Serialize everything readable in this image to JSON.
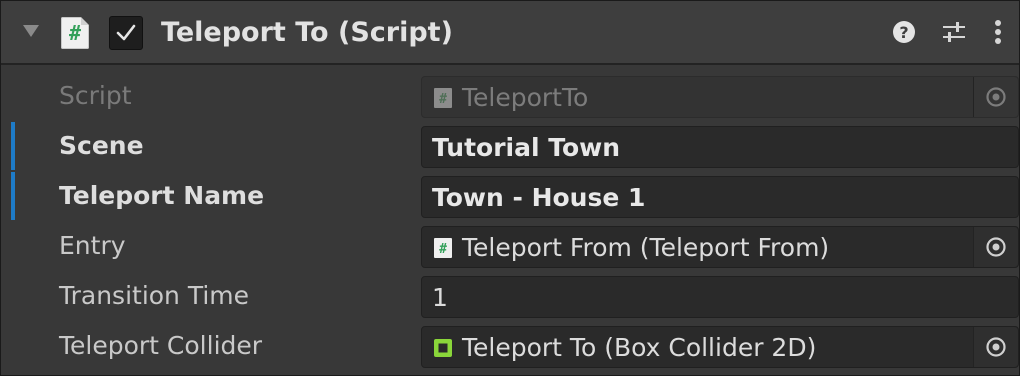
{
  "component": {
    "title": "Teleport To (Script)",
    "enabled": true,
    "icons": {
      "foldout": "foldout-arrow-icon",
      "script": "csharp-script-icon",
      "help": "help-icon",
      "presets": "presets-icon",
      "menu": "kebab-menu-icon"
    },
    "script_icon_glyph": "#"
  },
  "properties": [
    {
      "label": "Script",
      "value": "TeleportTo",
      "type": "object-reference",
      "icon": "csharp-script-icon",
      "disabled": true,
      "overridden": false
    },
    {
      "label": "Scene",
      "value": "Tutorial Town",
      "type": "text",
      "disabled": false,
      "overridden": true
    },
    {
      "label": "Teleport Name",
      "value": "Town - House 1",
      "type": "text",
      "disabled": false,
      "overridden": true
    },
    {
      "label": "Entry",
      "value": "Teleport From (Teleport From)",
      "type": "object-reference",
      "icon": "csharp-script-icon",
      "disabled": false,
      "overridden": false
    },
    {
      "label": "Transition Time",
      "value": "1",
      "type": "number",
      "disabled": false,
      "overridden": false
    },
    {
      "label": "Teleport Collider",
      "value": "Teleport To (Box Collider 2D)",
      "type": "object-reference",
      "icon": "box-collider-2d-icon",
      "disabled": false,
      "overridden": false
    }
  ],
  "colors": {
    "override_marker": "#1e7bc7",
    "script_icon_green": "#33a05a",
    "collider_icon_green": "#8ad63a"
  }
}
